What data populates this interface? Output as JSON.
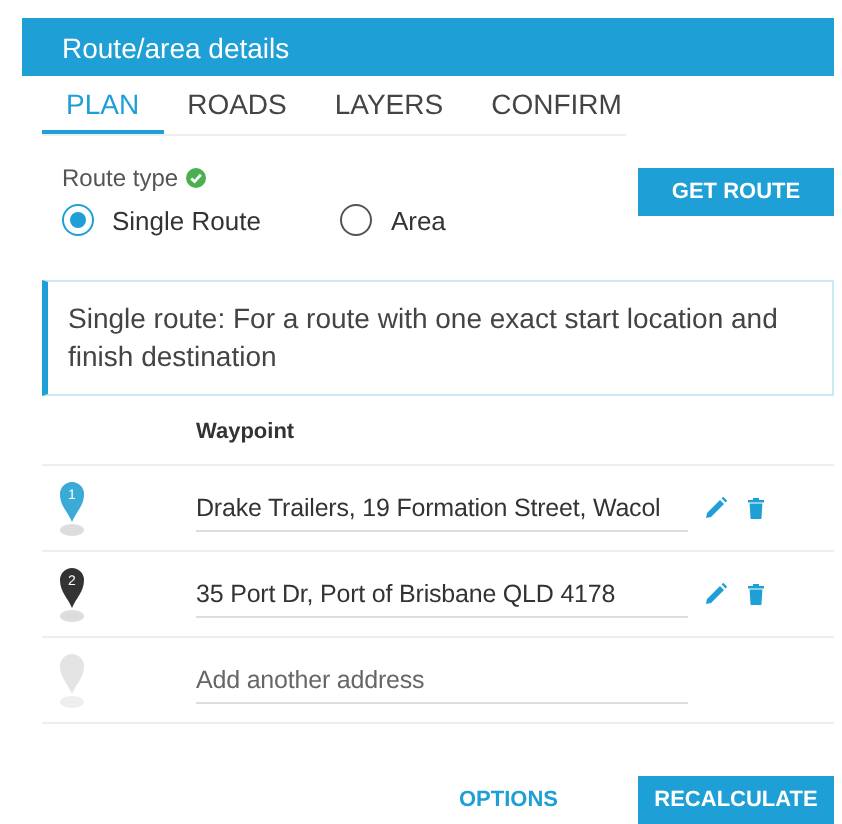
{
  "panel": {
    "title": "Route/area details"
  },
  "tabs": [
    {
      "label": "PLAN",
      "selected": true
    },
    {
      "label": "ROADS",
      "selected": false
    },
    {
      "label": "LAYERS",
      "selected": false
    },
    {
      "label": "CONFIRM",
      "selected": false
    }
  ],
  "route_type": {
    "label": "Route type",
    "valid": true,
    "options": [
      {
        "label": "Single Route",
        "selected": true
      },
      {
        "label": "Area",
        "selected": false
      }
    ]
  },
  "get_route_button": "GET ROUTE",
  "info": "Single route: For a route with one exact start location and finish destination",
  "waypoints": {
    "column": "Waypoint",
    "rows": [
      {
        "kind": "stop",
        "number": "1",
        "color": "#3aaad6",
        "value": "Drake Trailers, 19 Formation Street, Wacol"
      },
      {
        "kind": "stop",
        "number": "2",
        "color": "#333333",
        "value": "35 Port Dr, Port of Brisbane QLD 4178"
      },
      {
        "kind": "add",
        "placeholder": "Add another address"
      }
    ]
  },
  "footer": {
    "options": "OPTIONS",
    "recalculate": "RECALCULATE"
  }
}
